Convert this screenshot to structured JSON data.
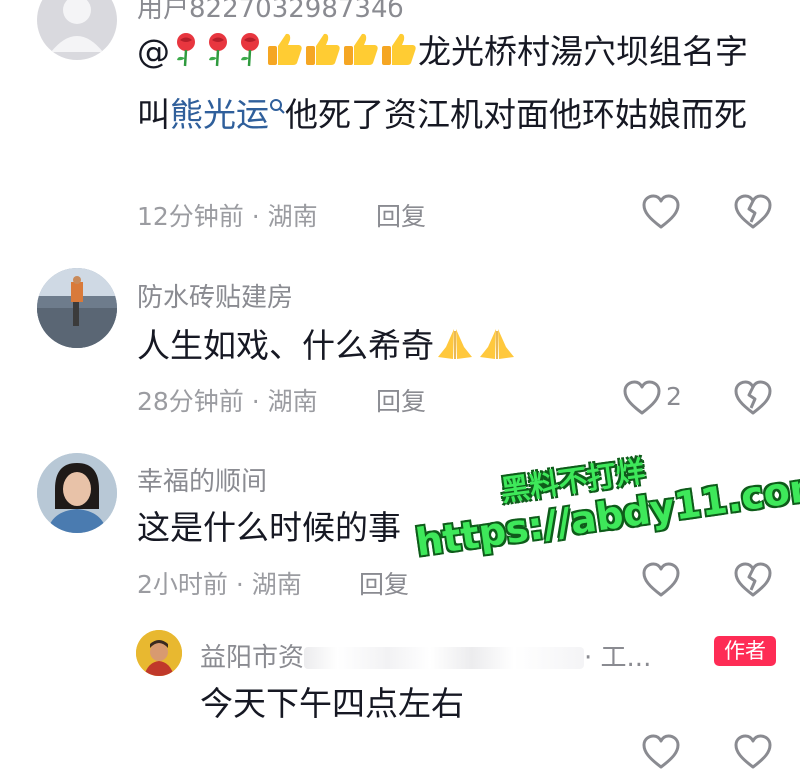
{
  "comments": [
    {
      "username": "用户822703298734б",
      "text_prefix": "@",
      "text_after_emoji": "龙光桥村湯穴坝组名字叫",
      "mention": "熊光运",
      "text_after_mention": "他死了资江机对面他环姑娘而死",
      "meta": "12分钟前 · 湖南",
      "reply_label": "回复",
      "emojis": [
        "rose-emoji",
        "rose-emoji",
        "rose-emoji",
        "thumbs-up-emoji",
        "thumbs-up-emoji",
        "thumbs-up-emoji",
        "thumbs-up-emoji"
      ]
    },
    {
      "username": "防水砖贴建房",
      "text": "人生如戏、什么希奇",
      "emojis": [
        "pray-emoji",
        "pray-emoji"
      ],
      "meta": "28分钟前 · 湖南",
      "reply_label": "回复",
      "like_count": "2"
    },
    {
      "username": "幸福的顺间",
      "text": "这是什么时候的事",
      "meta": "2小时前 · 湖南",
      "reply_label": "回复"
    },
    {
      "username": "益阳市资",
      "username_blurred": "· 工...",
      "author_badge": "作者",
      "text": "今天下午四点左右"
    }
  ],
  "watermark": {
    "line1": "黑料不打烊",
    "line2": "https://abdy11.com"
  },
  "colors": {
    "accent": "#fe2c55",
    "mention": "#2f5f9b",
    "watermark": "#3ee85a"
  },
  "icons": [
    "heart-outline-icon",
    "broken-heart-icon",
    "search-icon"
  ]
}
